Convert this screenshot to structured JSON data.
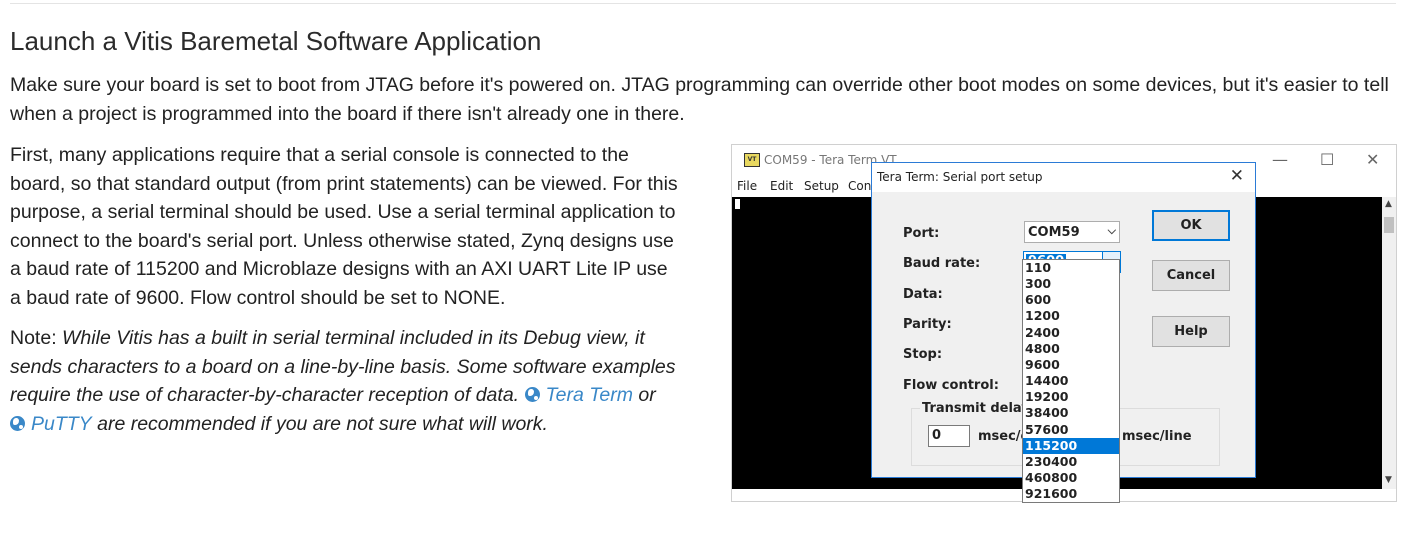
{
  "heading": "Launch a Vitis Baremetal Software Application",
  "intro": "Make sure your board is set to boot from JTAG before it's powered on. JTAG programming can override other boot modes on some devices, but it's easier to tell when a project is programmed into the board if there isn't already one in there.",
  "body": "First, many applications require that a serial console is connected to the board, so that standard output (from print statements) can be viewed. For this purpose, a serial terminal should be used. Use a serial terminal application to connect to the board's serial port. Unless otherwise stated, Zynq designs use a baud rate of 115200 and Microblaze designs with an AXI UART Lite IP use a baud rate of 9600. Flow control should be set to NONE.",
  "note": {
    "label": "Note:",
    "text1": "While Vitis has a built in serial terminal included in its Debug view, it sends characters to a board on a line-by-line basis. Some software examples require the use of character-by-character reception of data.",
    "link1": "Tera Term",
    "or": "or",
    "link2": "PuTTY",
    "text2": "are recommended if you are not sure what will work."
  },
  "screenshot": {
    "window_title": "COM59 - Tera Term VT",
    "vt_icon_text": "VT",
    "controls": {
      "minimize": "—",
      "maximize": "☐",
      "close": "✕"
    },
    "menu": [
      "File",
      "Edit",
      "Setup",
      "Con"
    ],
    "dialog": {
      "title": "Tera Term: Serial port setup",
      "close": "✕",
      "labels": {
        "port": "Port:",
        "baud": "Baud rate:",
        "data": "Data:",
        "parity": "Parity:",
        "stop": "Stop:",
        "flow": "Flow control:"
      },
      "port_value": "COM59",
      "baud_value": "9600",
      "buttons": {
        "ok": "OK",
        "cancel": "Cancel",
        "help": "Help"
      },
      "transmit_delay": {
        "label": "Transmit delay",
        "value": "0",
        "unit1": "msec/c",
        "unit2": "msec/line"
      },
      "baud_options": [
        "110",
        "300",
        "600",
        "1200",
        "2400",
        "4800",
        "9600",
        "14400",
        "19200",
        "38400",
        "57600",
        "115200",
        "230400",
        "460800",
        "921600"
      ],
      "baud_highlighted": "115200"
    }
  }
}
